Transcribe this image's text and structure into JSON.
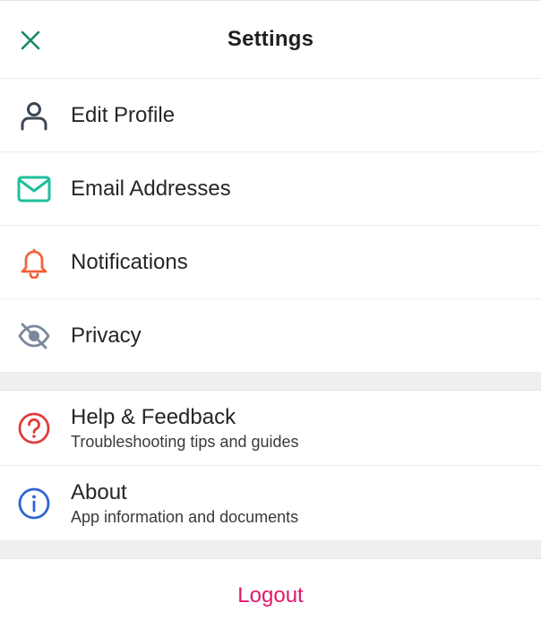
{
  "header": {
    "title": "Settings",
    "close_icon": "close-icon"
  },
  "menu_primary": [
    {
      "label": "Edit Profile",
      "icon": "user-icon",
      "color": "#3d4752"
    },
    {
      "label": "Email Addresses",
      "icon": "mail-icon",
      "color": "#1fbf9b"
    },
    {
      "label": "Notifications",
      "icon": "bell-icon",
      "color": "#f2633a"
    },
    {
      "label": "Privacy",
      "icon": "eye-off-icon",
      "color": "#7a8699"
    }
  ],
  "menu_secondary": [
    {
      "label": "Help & Feedback",
      "subtitle": "Troubleshooting tips and guides",
      "icon": "help-icon",
      "color": "#e23b3b"
    },
    {
      "label": "About",
      "subtitle": "App information and documents",
      "icon": "info-icon",
      "color": "#2f63d6"
    }
  ],
  "logout": {
    "label": "Logout",
    "color": "#e0196b"
  },
  "colors": {
    "accent_close": "#178a5a",
    "divider": "#ececec",
    "section_gap": "#efefef"
  }
}
